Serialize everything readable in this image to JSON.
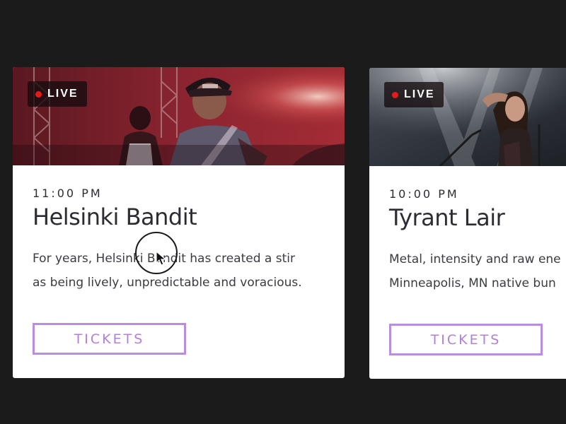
{
  "cards": [
    {
      "live_label": "LIVE",
      "time": "11:00 PM",
      "title": "Helsinki Bandit",
      "description_lines": [
        "For years, Helsinki Bandit has created a stir",
        "as being lively, unpredictable and voracious."
      ],
      "tickets_label": "TICKETS"
    },
    {
      "live_label": "LIVE",
      "time": "10:00 PM",
      "title": "Tyrant Lair",
      "description_lines": [
        "Metal, intensity and raw ene",
        "Minneapolis, MN native bun"
      ],
      "tickets_label": "TICKETS"
    }
  ],
  "colors": {
    "background": "#1b1b1b",
    "card": "#ffffff",
    "accent": "#b98ee0",
    "live_dot": "#e41b1b"
  },
  "icons": {
    "live_indicator": "red-dot-icon",
    "cursor": "mouse-pointer-icon"
  }
}
